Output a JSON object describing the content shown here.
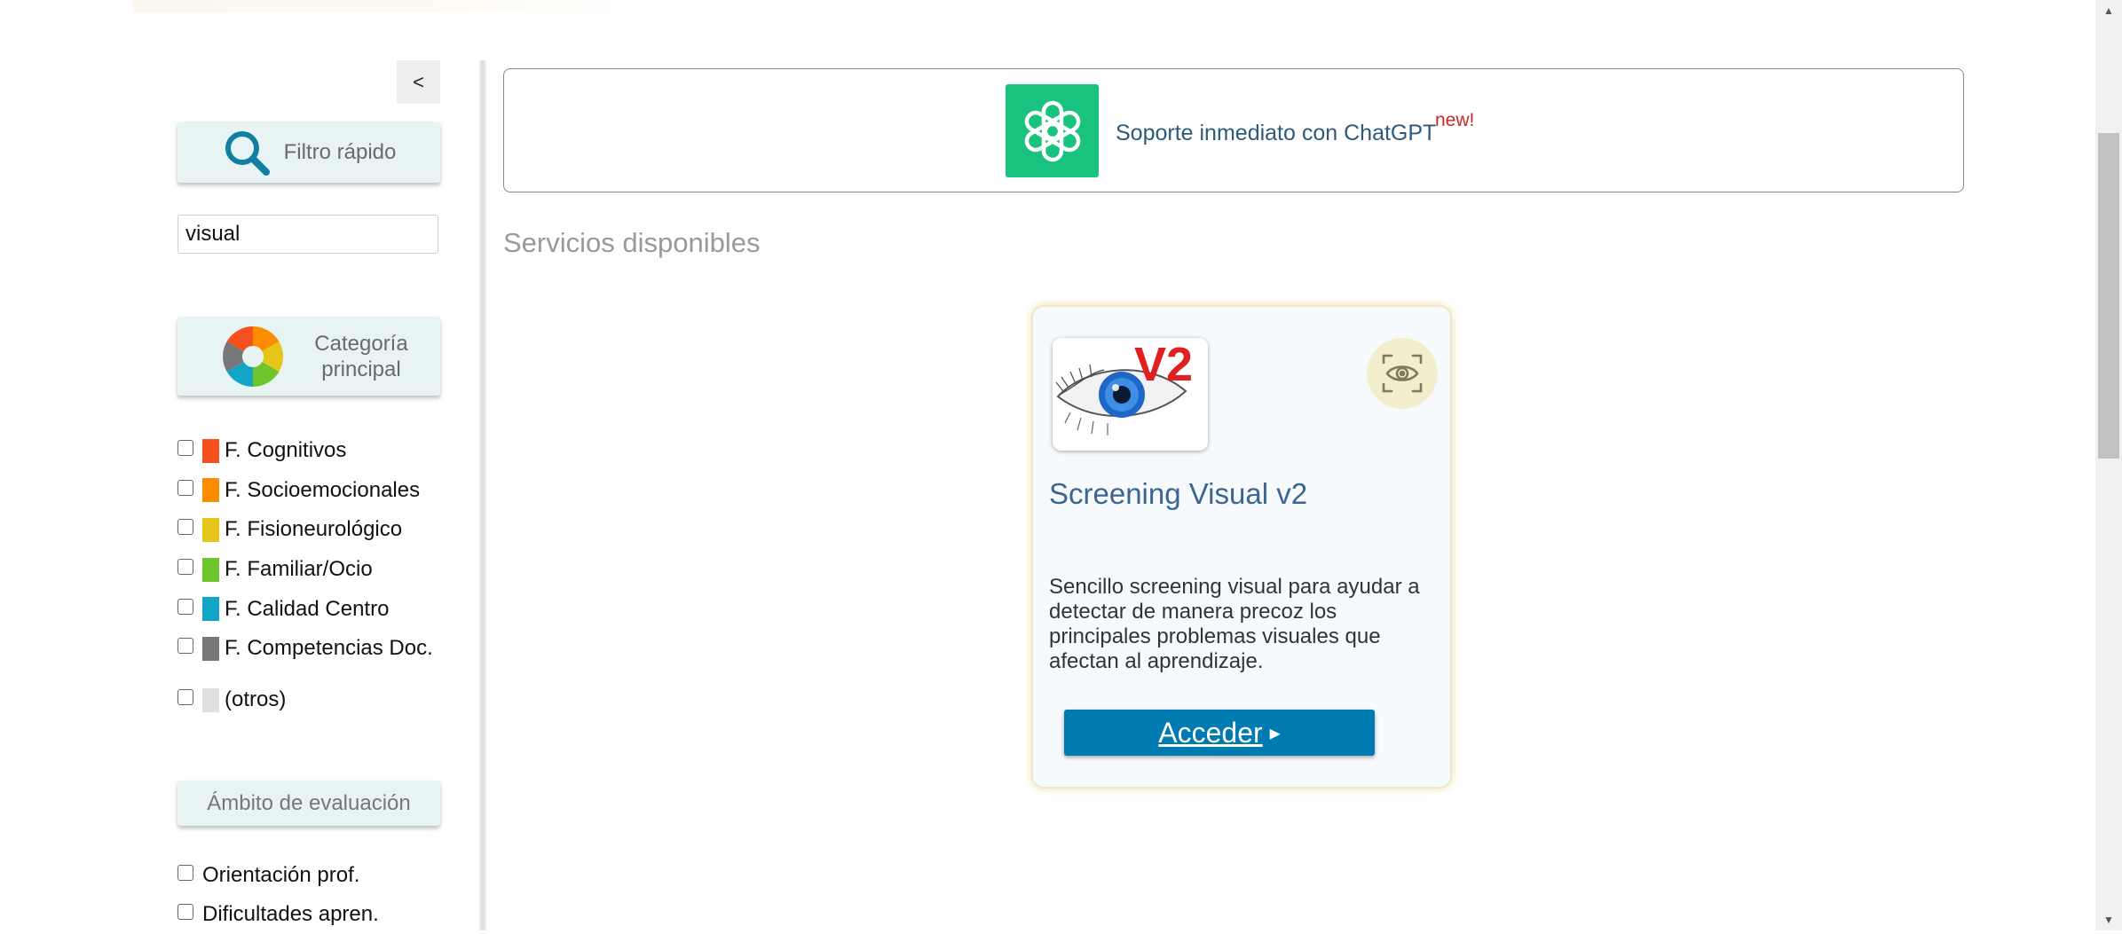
{
  "sidebar": {
    "collapse_label": "<",
    "filter_title": "Filtro rápido",
    "search_value": "visual",
    "category_title": "Categoría principal",
    "categories": [
      {
        "label": "F. Cognitivos",
        "color": "#f4511e"
      },
      {
        "label": "F. Socioemocionales",
        "color": "#fb8c00"
      },
      {
        "label": "F. Fisioneurológico",
        "color": "#e6c619"
      },
      {
        "label": "F. Familiar/Ocio",
        "color": "#6cc52a"
      },
      {
        "label": "F. Calidad Centro",
        "color": "#12a5c7"
      },
      {
        "label": "F. Competencias Doc.",
        "color": "#777777"
      }
    ],
    "other": {
      "label": "(otros)",
      "color": "#e0e0e0"
    },
    "scope_title": "Ámbito de evaluación",
    "scopes": [
      "Orientación prof.",
      "Dificultades apren."
    ]
  },
  "chat_banner": {
    "text": "Soporte inmediato con ChatGPT",
    "badge": "new!"
  },
  "main": {
    "section_title": "Servicios disponibles",
    "service": {
      "badge_text": "V2",
      "title": "Screening Visual v2",
      "description": "Sencillo screening visual para ayudar a detectar de manera precoz los principales problemas visuales que afectan al aprendizaje.",
      "access_label": "Acceder",
      "access_arrow": "▸"
    }
  }
}
